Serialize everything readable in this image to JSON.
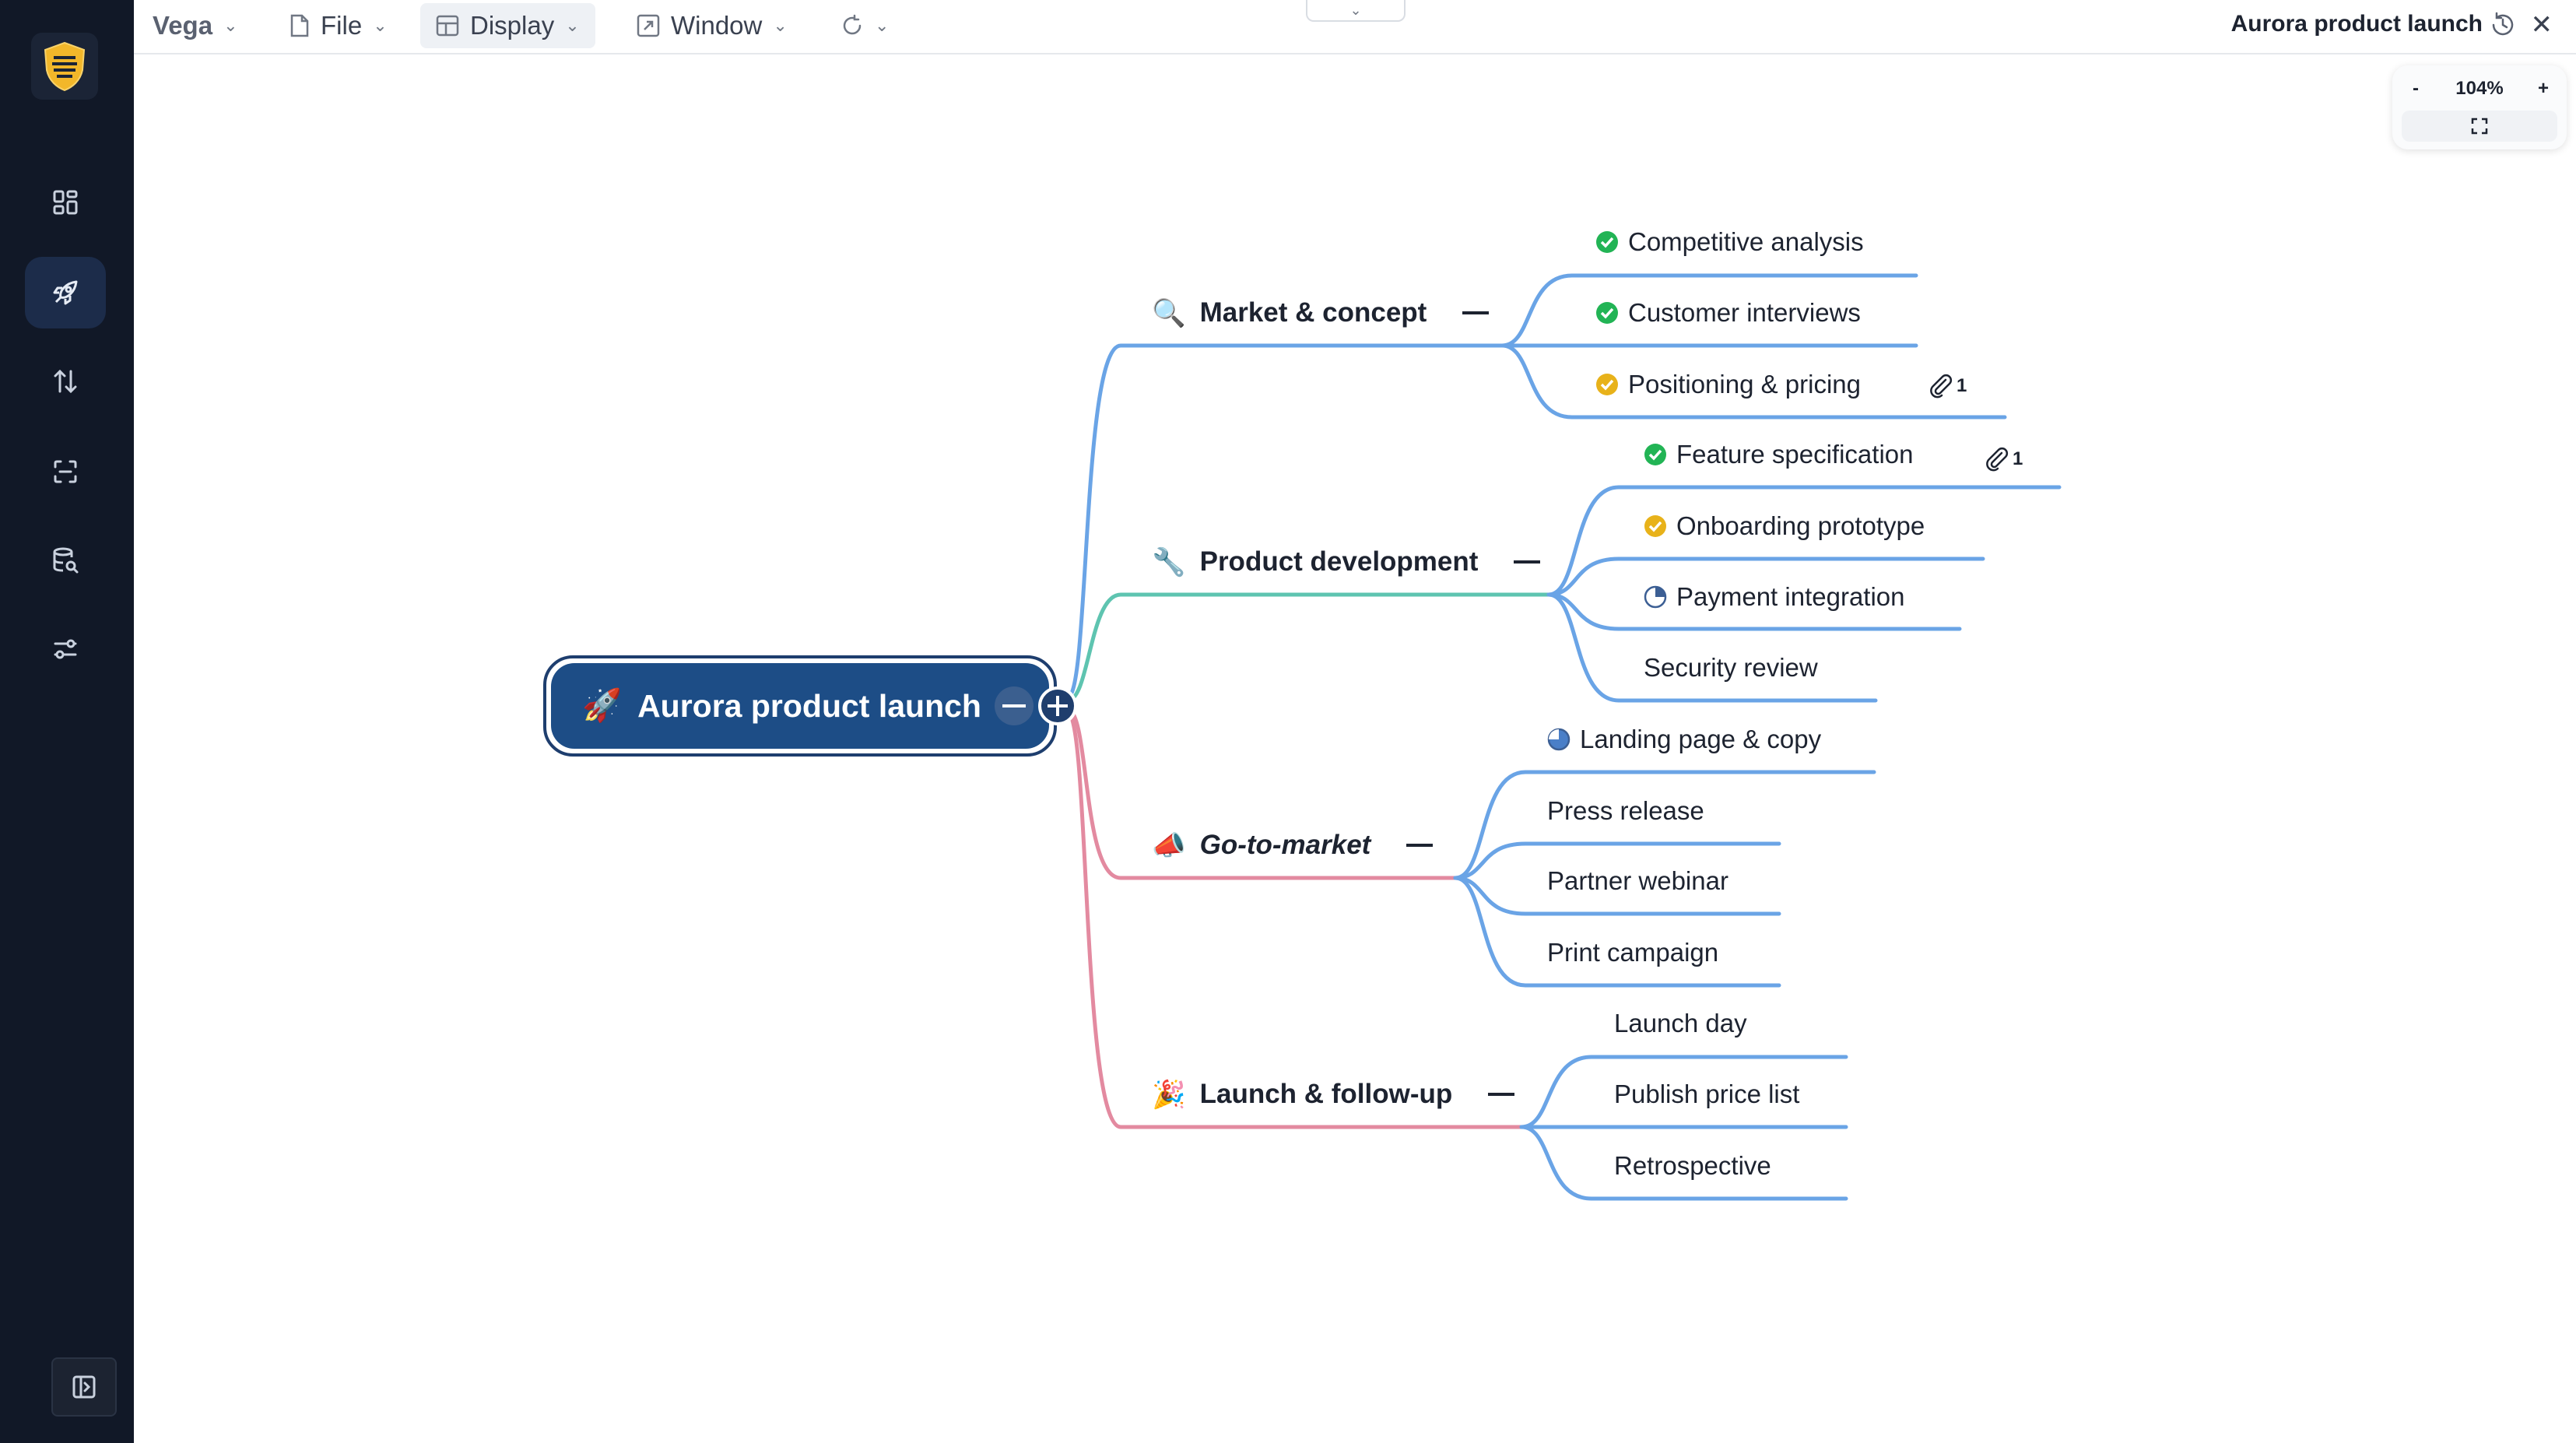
{
  "app": {
    "brand": "Vega"
  },
  "menus": [
    {
      "label": "File",
      "icon": "file-icon"
    },
    {
      "label": "Display",
      "icon": "table-icon"
    },
    {
      "label": "Window",
      "icon": "window-icon"
    },
    {
      "label": "",
      "icon": "refresh-icon"
    }
  ],
  "document": {
    "title": "Aurora product launch"
  },
  "zoom": {
    "level": "104%",
    "minus": "-",
    "plus": "+"
  },
  "sidebar": {
    "items": [
      {
        "name": "dashboard",
        "icon": "dashboard-icon",
        "active": false
      },
      {
        "name": "launch",
        "icon": "rocket-icon",
        "active": true
      },
      {
        "name": "sort",
        "icon": "sort-arrows-icon",
        "active": false
      },
      {
        "name": "capture",
        "icon": "scan-icon",
        "active": false
      },
      {
        "name": "database",
        "icon": "database-search-icon",
        "active": false
      },
      {
        "name": "settings",
        "icon": "sliders-icon",
        "active": false
      }
    ]
  },
  "mindmap": {
    "root": {
      "emoji": "🚀",
      "label": "Aurora product launch"
    },
    "branches": [
      {
        "emoji": "🔍",
        "label": "Market & concept",
        "color": "#6aa4e6",
        "children": [
          {
            "label": "Competitive analysis",
            "status": "done"
          },
          {
            "label": "Customer interviews",
            "status": "done"
          },
          {
            "label": "Positioning & pricing",
            "status": "review",
            "attachments": "1"
          }
        ]
      },
      {
        "emoji": "🔧",
        "label": "Product development",
        "color": "#5ec4b0",
        "children": [
          {
            "label": "Feature specification",
            "status": "done",
            "attachments": "1"
          },
          {
            "label": "Onboarding prototype",
            "status": "review"
          },
          {
            "label": "Payment integration",
            "status": "partial"
          },
          {
            "label": "Security review",
            "status": "none"
          }
        ]
      },
      {
        "emoji": "📣",
        "label": "Go-to-market",
        "color": "#e38aa0",
        "children": [
          {
            "label": "Landing page & copy",
            "status": "mostly"
          },
          {
            "label": "Press release",
            "status": "none"
          },
          {
            "label": "Partner webinar",
            "status": "none"
          },
          {
            "label": "Print campaign",
            "status": "none"
          }
        ]
      },
      {
        "emoji": "🎉",
        "label": "Launch & follow-up",
        "color": "#e38aa0",
        "children": [
          {
            "label": "Launch day",
            "status": "none"
          },
          {
            "label": "Publish price list",
            "status": "none"
          },
          {
            "label": "Retrospective",
            "status": "none"
          }
        ]
      }
    ],
    "leaf_line_color": "#6aa4e6",
    "status_colors": {
      "done": "#22b455",
      "review": "#e8b21a",
      "progress": "#3c5f94"
    }
  }
}
